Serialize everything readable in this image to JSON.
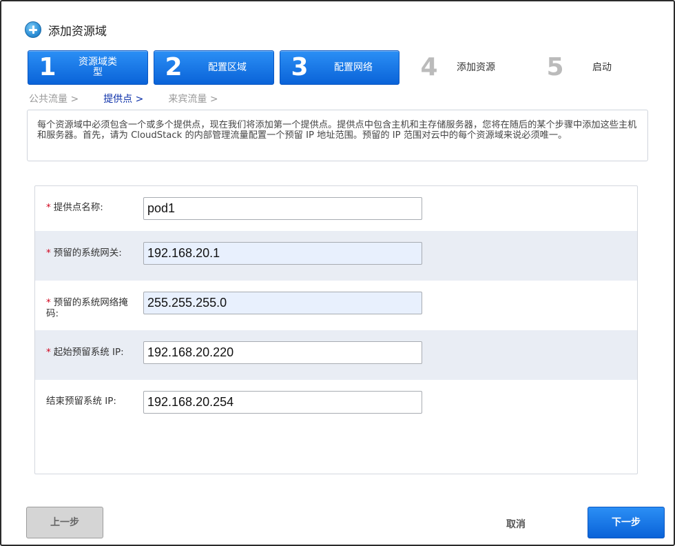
{
  "dialog": {
    "title": "添加资源域",
    "icon": "plus-circle-icon"
  },
  "steps": [
    {
      "num": "1",
      "label": "资源域类\n型",
      "state": "done"
    },
    {
      "num": "2",
      "label": "配置区域",
      "state": "done"
    },
    {
      "num": "3",
      "label": "配置网络",
      "state": "current"
    },
    {
      "num": "4",
      "label": "添加资源",
      "state": "pending"
    },
    {
      "num": "5",
      "label": "启动",
      "state": "pending"
    }
  ],
  "subnav": {
    "item1": "公共流量 >",
    "item2": "提供点 >",
    "item3": "来宾流量 >"
  },
  "description": "每个资源域中必须包含一个或多个提供点，现在我们将添加第一个提供点。提供点中包含主机和主存储服务器，您将在随后的某个步骤中添加这些主机和服务器。首先，请为 CloudStack 的内部管理流量配置一个预留 IP 地址范围。预留的 IP 范围对云中的每个资源域来说必须唯一。",
  "form": {
    "pod_name": {
      "label": "提供点名称:",
      "value": "pod1",
      "required": true
    },
    "gateway": {
      "label": "预留的系统网关:",
      "value": "192.168.20.1",
      "required": true
    },
    "netmask": {
      "label": "预留的系统网络掩码:",
      "value": "255.255.255.0",
      "required": true
    },
    "start_ip": {
      "label": "起始预留系统 IP:",
      "value": "192.168.20.220",
      "required": true
    },
    "end_ip": {
      "label": "结束预留系统 IP:",
      "value": "192.168.20.254",
      "required": false
    }
  },
  "buttons": {
    "prev": "上一步",
    "cancel": "取消",
    "next": "下一步"
  },
  "colors": {
    "accent": "#0a63d8",
    "required": "#d0021b",
    "row_alt": "#e9edf4"
  }
}
